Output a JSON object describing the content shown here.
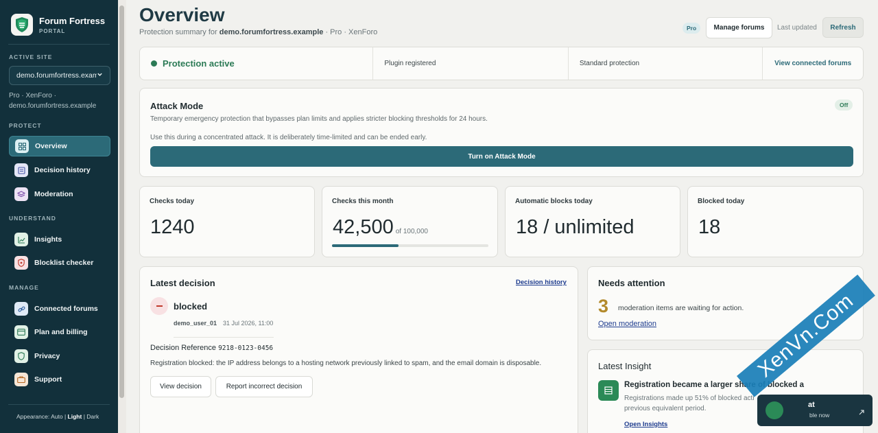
{
  "sidebar": {
    "brand_title": "Forum Fortress",
    "brand_sub": "PORTAL",
    "active_site_label": "ACTIVE SITE",
    "site_select_value": "demo.forumfortress.example",
    "site_meta": "Pro · XenForo · demo.forumfortress.example",
    "sections": {
      "protect": "PROTECT",
      "understand": "UNDERSTAND",
      "manage": "MANAGE"
    },
    "items": [
      {
        "label": "Overview",
        "icon": "grid-icon"
      },
      {
        "label": "Decision history",
        "icon": "history-icon"
      },
      {
        "label": "Moderation",
        "icon": "layers-icon"
      },
      {
        "label": "Insights",
        "icon": "chart-icon"
      },
      {
        "label": "Blocklist checker",
        "icon": "shield-icon"
      },
      {
        "label": "Connected forums",
        "icon": "link-icon"
      },
      {
        "label": "Plan and billing",
        "icon": "card-icon"
      },
      {
        "label": "Privacy",
        "icon": "privacy-shield-icon"
      },
      {
        "label": "Support",
        "icon": "briefcase-icon"
      }
    ],
    "appearance_label": "Appearance:",
    "appearance_options": [
      "Auto",
      "Light",
      "Dark"
    ]
  },
  "header": {
    "title": "Overview",
    "subtitle_prefix": "Protection summary for",
    "subtitle_domain": "demo.forumfortress.example",
    "subtitle_suffix": "· Pro · XenForo",
    "pro_badge": "Pro",
    "manage_forums": "Manage forums",
    "last_updated": "Last updated",
    "refresh": "Refresh"
  },
  "status": {
    "protection": "Protection active",
    "plugin": "Plugin registered",
    "level": "Standard protection",
    "view_forums": "View connected forums"
  },
  "attack_mode": {
    "title": "Attack Mode",
    "state": "Off",
    "desc": "Temporary emergency protection that bypasses plan limits and applies stricter blocking thresholds for 24 hours.",
    "note": "Use this during a concentrated attack. It is deliberately time-limited and can be ended early.",
    "button": "Turn on Attack Mode"
  },
  "kpis": [
    {
      "label": "Checks today",
      "value": "1240"
    },
    {
      "label": "Checks this month",
      "value": "42,500",
      "of": "of 100,000",
      "progress": 0.425
    },
    {
      "label": "Automatic blocks today",
      "value": "18 / unlimited"
    },
    {
      "label": "Blocked today",
      "value": "18"
    }
  ],
  "latest_decision": {
    "title": "Latest decision",
    "history_link": "Decision history",
    "result": "blocked",
    "user": "demo_user_01",
    "time": "31 Jul 2026, 11:00",
    "ref_label": "Decision Reference",
    "ref_value": "9218-0123-0456",
    "reason": "Registration blocked: the IP address belongs to a hosting network previously linked to spam, and the email domain is disposable.",
    "view_button": "View decision",
    "report_button": "Report incorrect decision"
  },
  "attention": {
    "title": "Needs attention",
    "count": "3",
    "text": "moderation items are waiting for action.",
    "link": "Open moderation"
  },
  "insight": {
    "title": "Latest Insight",
    "headline": "Registration became a larger share of blocked a",
    "body_line1": "Registrations made up 51% of blocked acti",
    "body_line2": "previous equivalent period.",
    "link": "Open Insights"
  },
  "chat": {
    "title": "at",
    "sub": "ble now"
  },
  "watermark": "XenVn.Com",
  "colors": {
    "sidebar": "#12303b",
    "accent": "#2c6a78",
    "success": "#2b7a55",
    "danger": "#c0392b",
    "attention": "#b38a2c"
  }
}
